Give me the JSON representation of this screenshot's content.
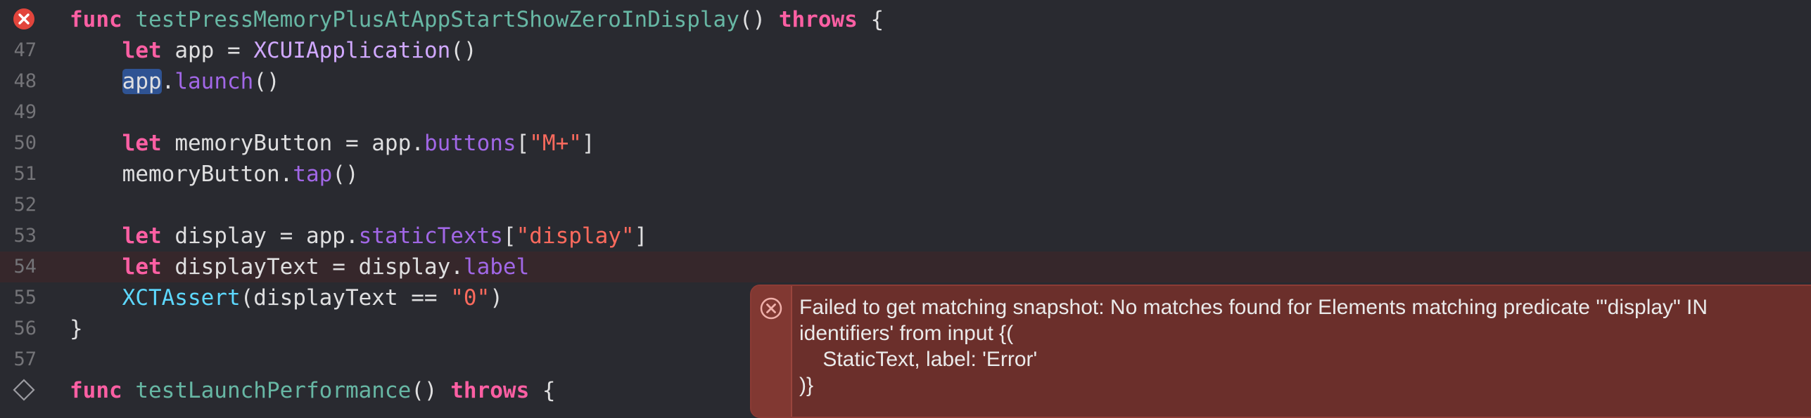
{
  "editor": {
    "theme_colors": {
      "background": "#292a30",
      "keyword": "#fc5fa3",
      "function_decl": "#67b7a4",
      "type": "#d0a8ff",
      "method": "#a167e6",
      "string": "#fc6a5d",
      "plain": "#dfdfe0",
      "error_bg": "#6b2f2b"
    },
    "gutter_icons": {
      "line_46": "error-circle-icon",
      "line_58": "diamond-test-icon"
    },
    "lines": [
      {
        "number": "",
        "tokens": [
          {
            "t": "func",
            "c": "kw"
          },
          {
            "t": " ",
            "c": "pln"
          },
          {
            "t": "testPressMemoryPlusAtAppStartShowZeroInDisplay",
            "c": "fn"
          },
          {
            "t": "() ",
            "c": "pln"
          },
          {
            "t": "throws",
            "c": "kw"
          },
          {
            "t": " {",
            "c": "pln"
          }
        ]
      },
      {
        "number": "47",
        "tokens": [
          {
            "t": "    ",
            "c": "pln"
          },
          {
            "t": "let",
            "c": "kw"
          },
          {
            "t": " app = ",
            "c": "pln"
          },
          {
            "t": "XCUIApplication",
            "c": "typ"
          },
          {
            "t": "()",
            "c": "pln"
          }
        ]
      },
      {
        "number": "48",
        "tokens": [
          {
            "t": "    ",
            "c": "pln"
          },
          {
            "t": "app",
            "c": "sel"
          },
          {
            "t": ".",
            "c": "pln"
          },
          {
            "t": "launch",
            "c": "mth"
          },
          {
            "t": "()",
            "c": "pln"
          }
        ]
      },
      {
        "number": "49",
        "tokens": []
      },
      {
        "number": "50",
        "tokens": [
          {
            "t": "    ",
            "c": "pln"
          },
          {
            "t": "let",
            "c": "kw"
          },
          {
            "t": " memoryButton = app.",
            "c": "pln"
          },
          {
            "t": "buttons",
            "c": "mth"
          },
          {
            "t": "[",
            "c": "pln"
          },
          {
            "t": "\"M+\"",
            "c": "str"
          },
          {
            "t": "]",
            "c": "pln"
          }
        ]
      },
      {
        "number": "51",
        "tokens": [
          {
            "t": "    memoryButton.",
            "c": "pln"
          },
          {
            "t": "tap",
            "c": "mth"
          },
          {
            "t": "()",
            "c": "pln"
          }
        ]
      },
      {
        "number": "52",
        "tokens": []
      },
      {
        "number": "53",
        "tokens": [
          {
            "t": "    ",
            "c": "pln"
          },
          {
            "t": "let",
            "c": "kw"
          },
          {
            "t": " display = app.",
            "c": "pln"
          },
          {
            "t": "staticTexts",
            "c": "mth"
          },
          {
            "t": "[",
            "c": "pln"
          },
          {
            "t": "\"display\"",
            "c": "str"
          },
          {
            "t": "]",
            "c": "pln"
          }
        ]
      },
      {
        "number": "54",
        "current": true,
        "tokens": [
          {
            "t": "    ",
            "c": "pln"
          },
          {
            "t": "let",
            "c": "kw"
          },
          {
            "t": " displayText = display.",
            "c": "pln"
          },
          {
            "t": "label",
            "c": "mth"
          }
        ]
      },
      {
        "number": "55",
        "tokens": [
          {
            "t": "    ",
            "c": "pln"
          },
          {
            "t": "XCTAssert",
            "c": "fnc"
          },
          {
            "t": "(displayText == ",
            "c": "pln"
          },
          {
            "t": "\"0\"",
            "c": "str"
          },
          {
            "t": ")",
            "c": "pln"
          }
        ]
      },
      {
        "number": "56",
        "tokens": [
          {
            "t": "}",
            "c": "pln"
          }
        ]
      },
      {
        "number": "57",
        "tokens": []
      },
      {
        "number": "",
        "tokens": [
          {
            "t": "func",
            "c": "kw"
          },
          {
            "t": " ",
            "c": "pln"
          },
          {
            "t": "testLaunchPerformance",
            "c": "fn"
          },
          {
            "t": "() ",
            "c": "pln"
          },
          {
            "t": "throws",
            "c": "kw"
          },
          {
            "t": " {",
            "c": "pln"
          }
        ]
      }
    ]
  },
  "issue": {
    "icon": "error-x-icon",
    "message": "Failed to get matching snapshot: No matches found for Elements matching predicate '\"display\" IN\nidentifiers' from input {(\n    StaticText, label: 'Error'\n)}"
  }
}
